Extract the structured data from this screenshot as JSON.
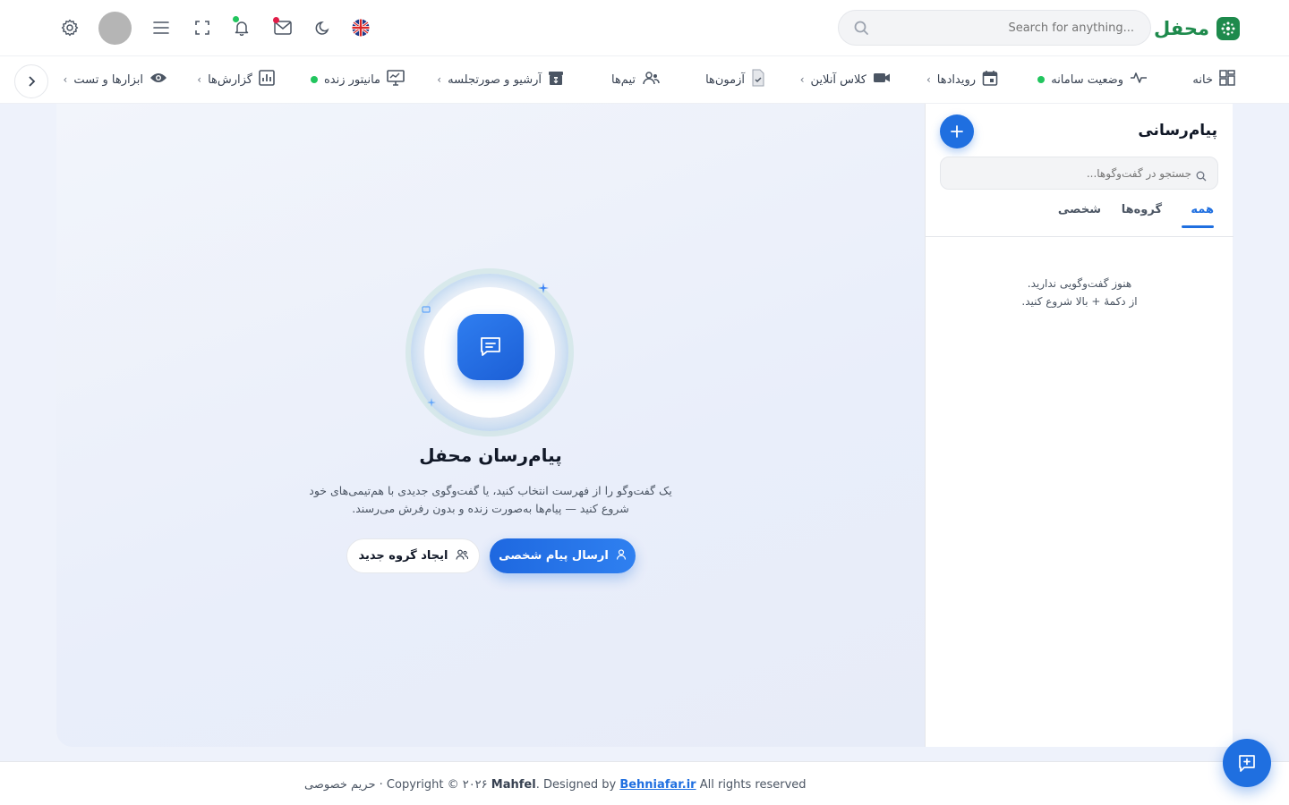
{
  "brand": {
    "name": "محفل"
  },
  "header": {
    "search_placeholder": "Search for anything..."
  },
  "nav": {
    "items": [
      {
        "label": "خانه",
        "icon": "dashboard-icon"
      },
      {
        "label": "وضعیت سامانه",
        "icon": "pulse-icon",
        "status": "green"
      },
      {
        "label": "رویدادها",
        "icon": "calendar-icon"
      },
      {
        "label": "کلاس آنلاین",
        "icon": "video-icon"
      },
      {
        "label": "آزمون‌ها",
        "icon": "exam-icon"
      },
      {
        "label": "تیم‌ها",
        "icon": "team-icon"
      },
      {
        "label": "آرشیو و صورتجلسه",
        "icon": "archive-icon"
      },
      {
        "label": "مانیتور زنده",
        "icon": "monitor-icon",
        "status": "green"
      },
      {
        "label": "گزارش‌ها",
        "icon": "report-icon"
      },
      {
        "label": "ابزارها و تست",
        "icon": "eye-icon"
      }
    ]
  },
  "sidebar": {
    "title": "پیام‌رسانی",
    "search_placeholder": "جستجو در گفت‌وگوها...",
    "tabs": [
      {
        "label": "همه",
        "active": true
      },
      {
        "label": "گروه‌ها",
        "active": false
      },
      {
        "label": "شخصی",
        "active": false
      }
    ],
    "empty_line1": "هنوز گفت‌وگویی ندارید.",
    "empty_line2": "از دکمهٔ + بالا شروع کنید."
  },
  "hero": {
    "title": "پیام‌رسان محفل",
    "description": "یک گفت‌وگو را از فهرست انتخاب کنید، یا گفت‌وگوی جدیدی با هم‌تیمی‌های خود شروع کنید — پیام‌ها به‌صورت زنده و بدون رفرش می‌رسند.",
    "primary_button": "ارسال پیام شخصی",
    "secondary_button": "ایجاد گروه جدید"
  },
  "footer": {
    "privacy": "حریم خصوصی",
    "copyright": "· Copyright © ۲۰۲۶",
    "brand": "Mahfel",
    "designed_by": ". Designed by",
    "designer_link": "Behniafar.ir",
    "rights": "All rights reserved"
  },
  "colors": {
    "primary": "#1f6fe0",
    "brand_green": "#1e8a4c",
    "status_green": "#22c55e",
    "notify_red": "#e11d48"
  }
}
